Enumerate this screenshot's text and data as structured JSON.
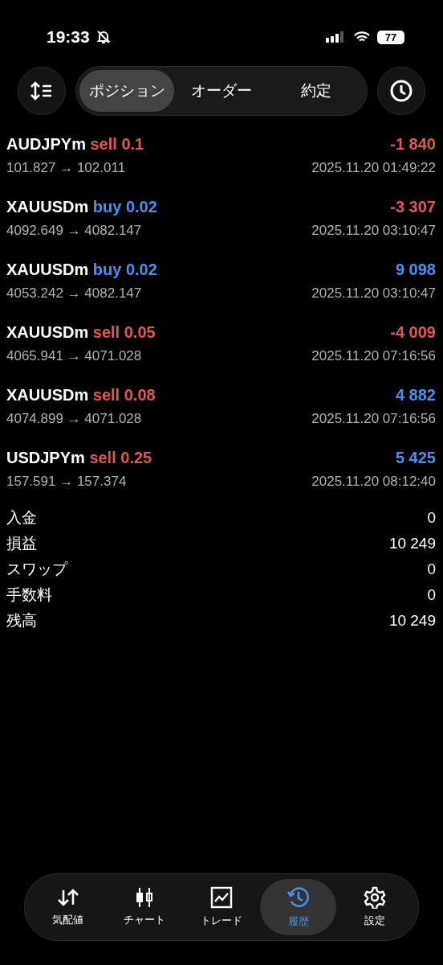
{
  "status_bar": {
    "time": "19:33",
    "battery": "77"
  },
  "tabs": [
    {
      "label": "ポジション",
      "selected": true
    },
    {
      "label": "オーダー",
      "selected": false
    },
    {
      "label": "約定",
      "selected": false
    }
  ],
  "deals": [
    {
      "symbol": "AUDJPYm",
      "side": "sell",
      "kind": "sell",
      "lot": "0.1",
      "profit": "-1 840",
      "color": "#e0584c",
      "prices": "101.827 → 102.011",
      "time": "2025.11.20 01:49:22"
    },
    {
      "symbol": "XAUUSDm",
      "side": "buy",
      "kind": "buy",
      "lot": "0.02",
      "profit": "-3 307",
      "color": "#e0584c",
      "prices": "4092.649 → 4082.147",
      "time": "2025.11.20 03:10:47"
    },
    {
      "symbol": "XAUUSDm",
      "side": "buy",
      "kind": "buy",
      "lot": "0.02",
      "profit": "9 098",
      "color": "#4a8ff0",
      "prices": "4053.242 → 4082.147",
      "time": "2025.11.20 03:10:47"
    },
    {
      "symbol": "XAUUSDm",
      "side": "sell",
      "kind": "sell",
      "lot": "0.05",
      "profit": "-4 009",
      "color": "#e0584c",
      "prices": "4065.941 → 4071.028",
      "time": "2025.11.20 07:16:56"
    },
    {
      "symbol": "XAUUSDm",
      "side": "sell",
      "kind": "sell",
      "lot": "0.08",
      "profit": "4 882",
      "color": "#4a8ff0",
      "prices": "4074.899 → 4071.028",
      "time": "2025.11.20 07:16:56"
    },
    {
      "symbol": "USDJPYm",
      "side": "sell",
      "kind": "sell",
      "lot": "0.25",
      "profit": "5 425",
      "color": "#4a8ff0",
      "prices": "157.591 → 157.374",
      "time": "2025.11.20 08:12:40"
    }
  ],
  "summary": [
    {
      "label": "入金",
      "value": "0"
    },
    {
      "label": "損益",
      "value": "10 249"
    },
    {
      "label": "スワップ",
      "value": "0"
    },
    {
      "label": "手数料",
      "value": "0"
    },
    {
      "label": "残高",
      "value": "10 249"
    }
  ],
  "nav": [
    {
      "label": "気配値",
      "kind": "quotes",
      "selected": false
    },
    {
      "label": "チャート",
      "kind": "chart",
      "selected": false
    },
    {
      "label": "トレード",
      "kind": "trade",
      "selected": false
    },
    {
      "label": "履歴",
      "kind": "history",
      "selected": true
    },
    {
      "label": "設定",
      "kind": "settings",
      "selected": false
    }
  ]
}
